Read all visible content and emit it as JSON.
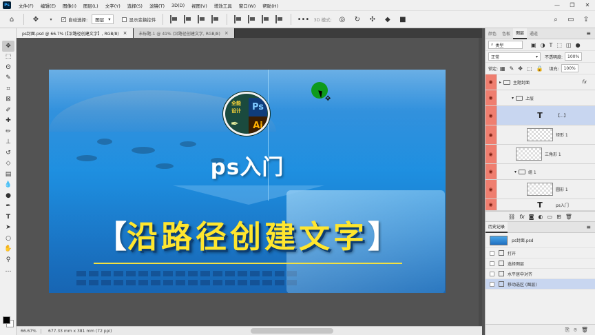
{
  "menu": {
    "logo": "Ps",
    "items": [
      "文件(F)",
      "编辑(E)",
      "图像(I)",
      "图层(L)",
      "文字(Y)",
      "选择(S)",
      "滤镜(T)",
      "3D(D)",
      "视图(V)",
      "增效工具",
      "窗口(W)",
      "帮助(H)"
    ],
    "window_controls": [
      "—",
      "❐",
      "✕"
    ]
  },
  "options": {
    "auto_select_label": "自动选择:",
    "auto_select_target": "图层",
    "show_transform_label": "显示变换控件",
    "mode_3d_label": "3D 模式:"
  },
  "tabs": [
    {
      "label": "ps封面.psd @ 66.7% (【沿路径创建文字】, RGB/8)",
      "close": "×"
    },
    {
      "label": "未标题-1 @ 41% (沿路径创建文字, RGB/8)",
      "close": "×"
    }
  ],
  "canvas": {
    "logo_ps": "Ps",
    "logo_ai": "Ai",
    "logo_text_1": "全能",
    "logo_text_2": "设计",
    "subtitle": "ps入门",
    "bracket_left": "【",
    "bracket_right": "】",
    "main_title": "沿路径创建文字"
  },
  "status": {
    "zoom": "66.67%",
    "doc_info": "677.33 mm x 381 mm (72 ppi)"
  },
  "layers_panel": {
    "tabs": [
      "颜色",
      "色板",
      "图层",
      "通道"
    ],
    "filter_label": "类型",
    "blend_mode": "正常",
    "opacity_label": "不透明度:",
    "opacity_value": "100%",
    "lock_label": "锁定:",
    "fill_label": "填充:",
    "fill_value": "100%",
    "layers": [
      {
        "name": "主题封面",
        "kind": "group",
        "fx": "fx"
      },
      {
        "name": "上层",
        "kind": "group"
      },
      {
        "name": "【...】",
        "kind": "text",
        "thumb": "T"
      },
      {
        "name": "矩形 1",
        "kind": "shape"
      },
      {
        "name": "三角形 1",
        "kind": "shape"
      },
      {
        "name": "组 1",
        "kind": "group"
      },
      {
        "name": "圆形 1",
        "kind": "shape"
      },
      {
        "name": "ps入门",
        "kind": "text",
        "thumb": "T"
      }
    ]
  },
  "history_panel": {
    "title": "历史记录",
    "snapshot": "ps封面.psd",
    "items": [
      "打开",
      "选择图层",
      "水平居中对齐",
      "移动选区 (图层)"
    ]
  },
  "colors": {
    "accent_selected": "#c8d6f0",
    "eye_column": "#ef7e6f",
    "title_yellow": "#ffe62e",
    "canvas_blue": "#1e8fe0"
  }
}
